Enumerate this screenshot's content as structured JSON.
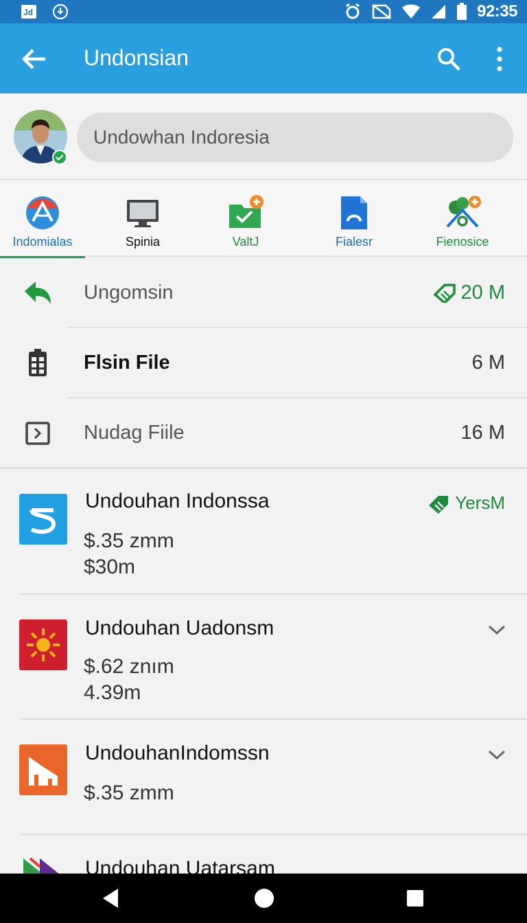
{
  "status_bar": {
    "clock": "92:35",
    "icons": [
      "media-icon",
      "download-icon",
      "alarm-icon",
      "no-sim-icon",
      "wifi-icon",
      "signal-icon",
      "battery-icon"
    ]
  },
  "app_bar": {
    "title": "Undonsian",
    "icons": [
      "back-arrow-icon",
      "search-icon",
      "more-vert-icon"
    ]
  },
  "account": {
    "search_text": "Undowhan Indoresia"
  },
  "categories": [
    {
      "label": "Indomialas",
      "color": "#1c6fb5",
      "active": true,
      "icon": "browser-icon"
    },
    {
      "label": "Spinia",
      "color": "#111111",
      "active": false,
      "icon": "monitor-icon"
    },
    {
      "label": "ValtJ",
      "color": "#1e8a3c",
      "active": false,
      "icon": "folder-check-icon"
    },
    {
      "label": "Fialesr",
      "color": "#1c6fb5",
      "active": false,
      "icon": "document-icon"
    },
    {
      "label": "Fienosice",
      "color": "#1e8a3c",
      "active": false,
      "icon": "home-tree-icon"
    }
  ],
  "files": [
    {
      "name": "Ungomsin",
      "size": "20 M",
      "icon": "share-arrow-icon"
    },
    {
      "name": "Flsin File",
      "size": "6 M",
      "icon": "calendar-grid-icon"
    },
    {
      "name": "Nudag Fiile",
      "size": "16 M",
      "icon": "terminal-box-icon"
    }
  ],
  "apps": [
    {
      "name": "Undouhan Indonssa",
      "line1": "$.35 zmm",
      "line2": "$30m",
      "right": "YersM",
      "icon": "s-logo-icon"
    },
    {
      "name": "Undouhan Uadonsm",
      "line1": "$.62 znım",
      "line2": "4.39m",
      "icon": "sun-logo-icon"
    },
    {
      "name": "UndouhanIndomssn",
      "line1": "$.35 zmm",
      "icon": "building-logo-icon"
    },
    {
      "name": "Undouhan Uatarsam",
      "icon": "flag-logo-icon"
    }
  ],
  "colors": {
    "app_bar": "#2a9fe0",
    "status_bar": "#1f78bf",
    "accent_green": "#1e8a3c"
  }
}
